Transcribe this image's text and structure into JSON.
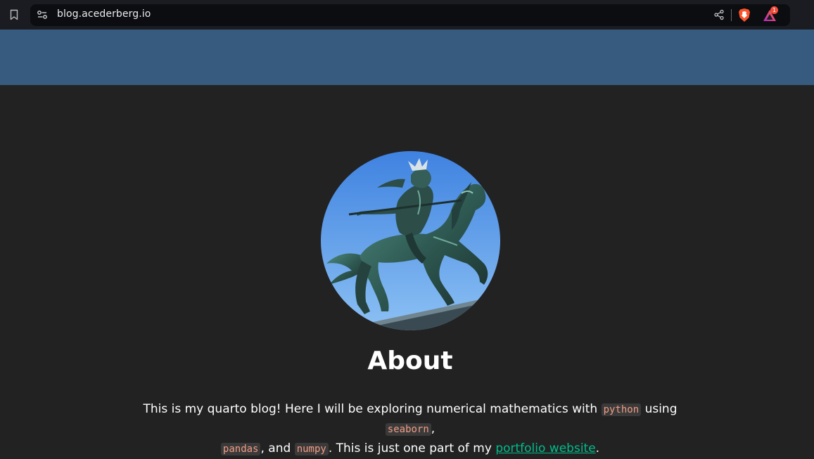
{
  "browser": {
    "url": "blog.acederberg.io",
    "rewards_badge_count": "1",
    "icons": [
      "bookmark-icon",
      "site-info-icon",
      "share-icon",
      "brave-shields-icon",
      "brave-rewards-icon"
    ]
  },
  "navbar": {
    "color": "#375a7f"
  },
  "profile": {
    "image_alt": "bronze samurai on horseback statue"
  },
  "about": {
    "title": "About",
    "text_intro": "This is my quarto blog! Here I will be exploring numerical mathematics with ",
    "code_python": "python",
    "text_using": " using ",
    "code_seaborn": "seaborn",
    "text_comma": ",",
    "code_pandas": "pandas",
    "text_and": ", and ",
    "code_numpy": "numpy",
    "text_part": ". This is just one part of my ",
    "link_portfolio": "portfolio website",
    "text_end": "."
  },
  "colors": {
    "page_background": "#222222",
    "link": "#00bc8c",
    "code": "#f29c84"
  }
}
